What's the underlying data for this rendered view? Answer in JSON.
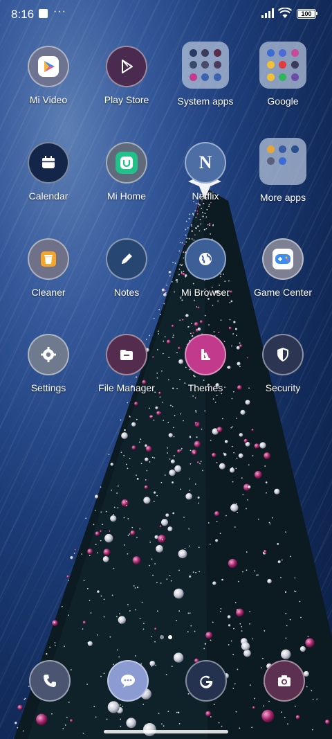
{
  "status_bar": {
    "time": "8:16",
    "overflow": "···",
    "battery": "100"
  },
  "apps": [
    {
      "id": "mi-video",
      "label": "Mi Video",
      "icon": "mi-video-icon",
      "bg": "#6e7390"
    },
    {
      "id": "play-store",
      "label": "Play Store",
      "icon": "play-store-icon",
      "bg": "#4a2a4e"
    },
    {
      "id": "system-apps",
      "label": "System apps",
      "icon": "folder-icon",
      "bg": "folder"
    },
    {
      "id": "google",
      "label": "Google",
      "icon": "folder-icon",
      "bg": "folder"
    },
    {
      "id": "calendar",
      "label": "Calendar",
      "icon": "calendar-icon",
      "bg": "#13264a"
    },
    {
      "id": "mi-home",
      "label": "Mi Home",
      "icon": "mi-home-icon",
      "bg": "#5f6a7d"
    },
    {
      "id": "netflix",
      "label": "Netflix",
      "icon": "netflix-icon",
      "bg": "#4c6ea4"
    },
    {
      "id": "more-apps",
      "label": "More apps",
      "icon": "folder-icon",
      "bg": "folder"
    },
    {
      "id": "cleaner",
      "label": "Cleaner",
      "icon": "cleaner-icon",
      "bg": "#6f7188"
    },
    {
      "id": "notes",
      "label": "Notes",
      "icon": "pencil-icon",
      "bg": "#274672"
    },
    {
      "id": "mi-browser",
      "label": "Mi Browser",
      "icon": "globe-icon",
      "bg": "#3d5f97"
    },
    {
      "id": "game-center",
      "label": "Game Center",
      "icon": "gamepad-icon",
      "bg": "#7c8092"
    },
    {
      "id": "settings",
      "label": "Settings",
      "icon": "gear-icon",
      "bg": "#6f7a8e"
    },
    {
      "id": "file-manager",
      "label": "File Manager",
      "icon": "folder-file-icon",
      "bg": "#532c4e"
    },
    {
      "id": "themes",
      "label": "Themes",
      "icon": "themes-icon",
      "bg": "#c23a8c"
    },
    {
      "id": "security",
      "label": "Security",
      "icon": "shield-icon",
      "bg": "#2c3552"
    }
  ],
  "folders": {
    "system-apps": [
      "#283a63",
      "#3b3b5c",
      "#5a2a49",
      "#3a4a6a",
      "#4a4a6a",
      "#4c3b5c",
      "#c33a8f",
      "#3c63b0",
      "#3c63b0"
    ],
    "google": [
      "#3b6cd6",
      "#4b6bd9",
      "#c84a9a",
      "#f2c037",
      "#e43b3b",
      "#3b3b5c",
      "#f2c037",
      "#2fb55a",
      "#6b4ca8"
    ],
    "more-apps": [
      "#e7a63a",
      "#3b5aa6",
      "#2a4f8f",
      "#5a5f7e",
      "#3b6cd6",
      "#ffffff00",
      "#ffffff00",
      "#ffffff00",
      "#ffffff00"
    ]
  },
  "dock": [
    {
      "id": "phone",
      "icon": "phone-icon",
      "bg": "#4a5571"
    },
    {
      "id": "messaging",
      "icon": "message-icon",
      "bg": "#8d9bd3"
    },
    {
      "id": "google-app",
      "icon": "google-g-icon",
      "bg": "#24324f"
    },
    {
      "id": "camera",
      "icon": "camera-icon",
      "bg": "#5b3050"
    }
  ],
  "page_indicator": {
    "count": 2,
    "active": 1
  }
}
